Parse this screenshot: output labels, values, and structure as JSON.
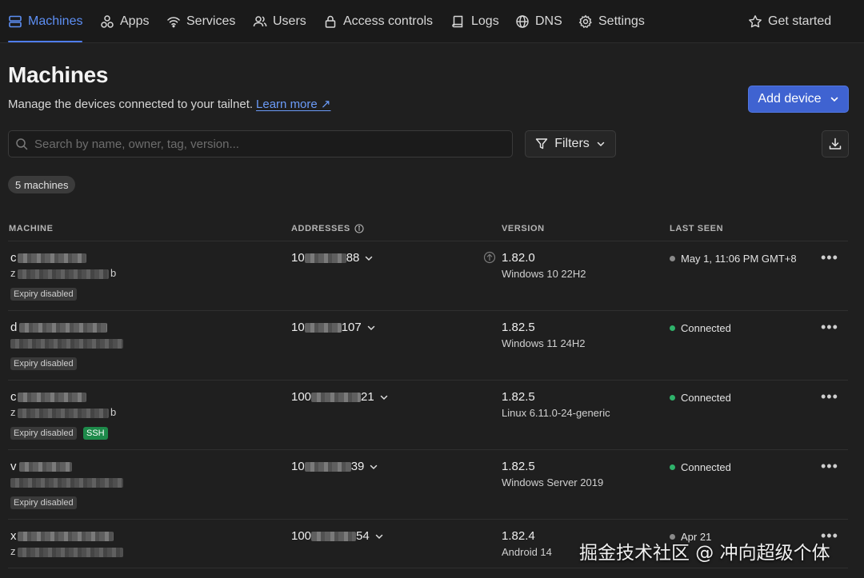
{
  "nav": {
    "items": [
      {
        "label": "Machines"
      },
      {
        "label": "Apps"
      },
      {
        "label": "Services"
      },
      {
        "label": "Users"
      },
      {
        "label": "Access controls"
      },
      {
        "label": "Logs"
      },
      {
        "label": "DNS"
      },
      {
        "label": "Settings"
      }
    ],
    "get_started": "Get started",
    "active_color": "#5d8ff4"
  },
  "header": {
    "title": "Machines",
    "subtitle": "Manage the devices connected to your tailnet.",
    "learn_more": "Learn more ↗",
    "add_device": "Add device"
  },
  "search": {
    "placeholder": "Search by name, owner, tag, version..."
  },
  "filters_label": "Filters",
  "count_badge": "5 machines",
  "table": {
    "columns": {
      "machine": "MACHINE",
      "addresses": "ADDRESSES",
      "version": "VERSION",
      "last_seen": "LAST SEEN"
    },
    "rows": [
      {
        "name_prefix": "c",
        "addr_prefix": "10",
        "addr_suffix": "88",
        "version": "1.82.0",
        "os": "Windows 10 22H2",
        "last_seen": "May 1, 11:06 PM GMT+8",
        "status": "offline",
        "tag_expiry": "Expiry disabled",
        "owner_prefix": "z",
        "owner_suffix": "b"
      },
      {
        "name_prefix": "d",
        "addr_prefix": "10",
        "addr_suffix": "107",
        "version": "1.82.5",
        "os": "Windows 11 24H2",
        "last_seen": "Connected",
        "status": "online",
        "tag_expiry": "Expiry disabled",
        "owner_prefix": "",
        "owner_suffix": ""
      },
      {
        "name_prefix": "c",
        "addr_prefix": "100",
        "addr_suffix": "21",
        "version": "1.82.5",
        "os": "Linux 6.11.0-24-generic",
        "last_seen": "Connected",
        "status": "online",
        "tag_expiry": "Expiry disabled",
        "tag_ssh": "SSH",
        "owner_prefix": "z",
        "owner_suffix": "b"
      },
      {
        "name_prefix": "v",
        "addr_prefix": "10",
        "addr_suffix": "39",
        "version": "1.82.5",
        "os": "Windows Server 2019",
        "last_seen": "Connected",
        "status": "online",
        "tag_expiry": "Expiry disabled",
        "owner_prefix": "",
        "owner_suffix": ""
      },
      {
        "name_prefix": "x",
        "addr_prefix": "100",
        "addr_suffix": "54",
        "version": "1.82.4",
        "os": "Android 14",
        "last_seen": "Apr 21",
        "status": "offline",
        "owner_prefix": "z",
        "owner_suffix": ""
      }
    ]
  },
  "colors": {
    "online": "#2fb36b",
    "offline": "#8a8a8a",
    "primary": "#3f63d1"
  },
  "watermark": "掘金技术社区 @ 冲向超级个体"
}
